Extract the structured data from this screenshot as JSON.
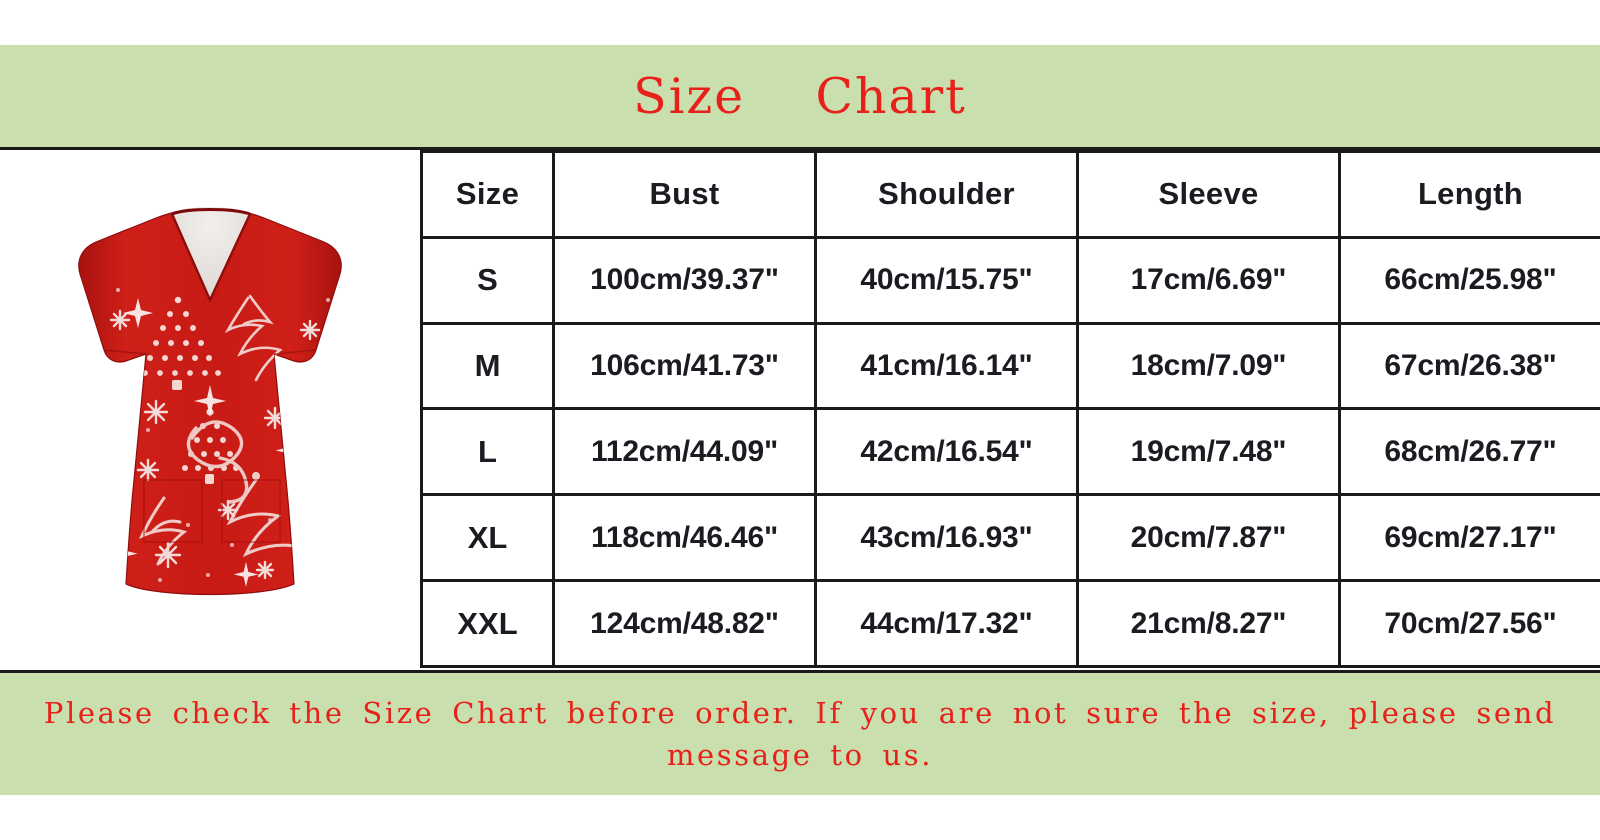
{
  "header": {
    "title": "Size    Chart",
    "title_word_1": "Size",
    "title_word_2": "Chart",
    "band_color": "#c9e0ae",
    "title_color": "#e8201a"
  },
  "product": {
    "alt": "red christmas print v-neck scrub top",
    "fabric_color": "#c21a16",
    "print_color": "#f6e3e0"
  },
  "chart_data": {
    "type": "table",
    "title": "Size Chart",
    "columns": [
      "Size",
      "Bust",
      "Shoulder",
      "Sleeve",
      "Length"
    ],
    "rows": [
      [
        "S",
        "100cm/39.37\"",
        "40cm/15.75\"",
        "17cm/6.69\"",
        "66cm/25.98\""
      ],
      [
        "M",
        "106cm/41.73\"",
        "41cm/16.14\"",
        "18cm/7.09\"",
        "67cm/26.38\""
      ],
      [
        "L",
        "112cm/44.09\"",
        "42cm/16.54\"",
        "19cm/7.48\"",
        "68cm/26.77\""
      ],
      [
        "XL",
        "118cm/46.46\"",
        "43cm/16.93\"",
        "20cm/7.87\"",
        "69cm/27.17\""
      ],
      [
        "XXL",
        "124cm/48.82\"",
        "44cm/17.32\"",
        "21cm/8.27\"",
        "70cm/27.56\""
      ]
    ],
    "units": {
      "bust_cm": [
        100,
        106,
        112,
        118,
        124
      ],
      "bust_in": [
        39.37,
        41.73,
        44.09,
        46.46,
        48.82
      ],
      "shoulder_cm": [
        40,
        41,
        42,
        43,
        44
      ],
      "shoulder_in": [
        15.75,
        16.14,
        16.54,
        16.93,
        17.32
      ],
      "sleeve_cm": [
        17,
        18,
        19,
        20,
        21
      ],
      "sleeve_in": [
        6.69,
        7.09,
        7.48,
        7.87,
        8.27
      ],
      "length_cm": [
        66,
        67,
        68,
        69,
        70
      ],
      "length_in": [
        25.98,
        26.38,
        26.77,
        27.17,
        27.56
      ]
    },
    "grid": true,
    "border_color": "#1a1a1a"
  },
  "footer": {
    "note": "Please check the Size Chart before order. If you are not sure the size, please send message to us.",
    "band_color": "#c9e0ae",
    "text_color": "#e8201a"
  }
}
